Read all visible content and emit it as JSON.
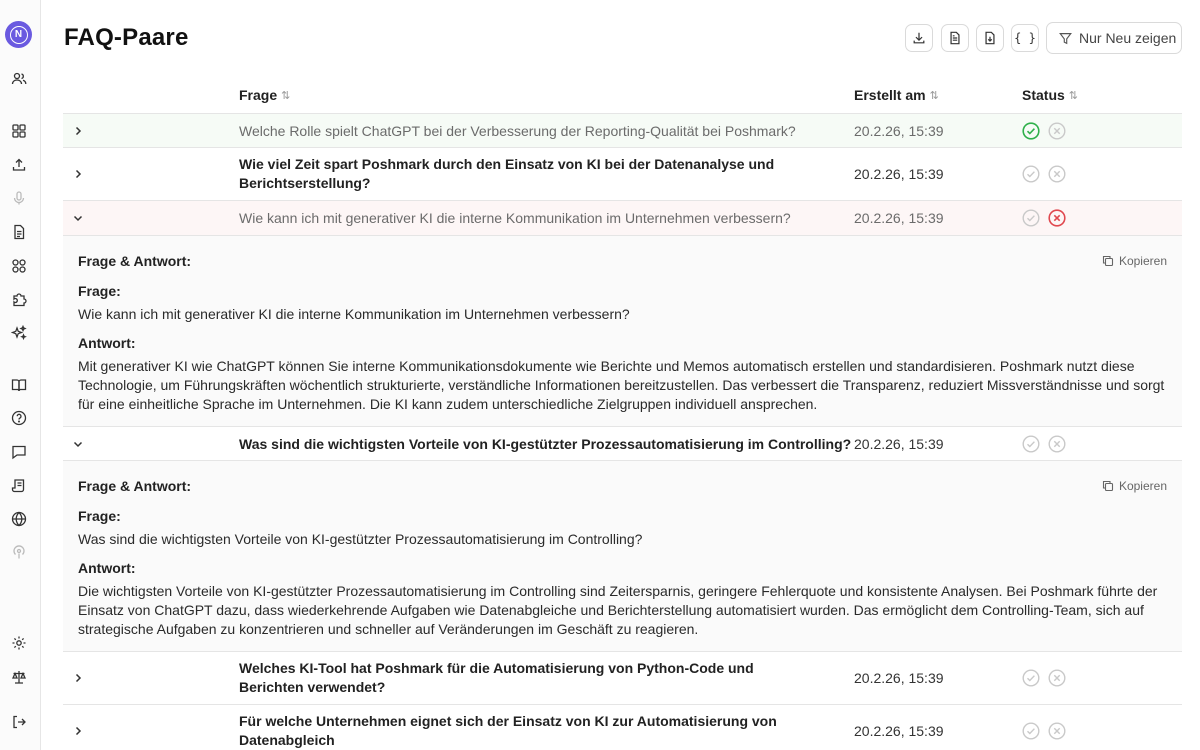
{
  "page": {
    "title": "FAQ-Paare"
  },
  "sidebar": {
    "logo_text": "N",
    "icons": [
      "users-icon",
      "dashboard-icon",
      "upload-icon",
      "microphone-icon",
      "document-icon",
      "integration-icon",
      "puzzle-icon",
      "sparkles-icon",
      "book-icon",
      "help-icon",
      "chat-icon",
      "script-icon",
      "globe-icon",
      "podcast-icon",
      "settings-icon",
      "scale-icon",
      "logout-icon"
    ]
  },
  "toolbar": {
    "buttons": [
      "download-icon",
      "file-text-icon",
      "file-download-icon",
      "code-braces-icon"
    ],
    "braces": "{ }",
    "filter_label": "Nur Neu zeigen"
  },
  "table": {
    "columns": {
      "question": "Frage",
      "created": "Erstellt am",
      "status": "Status"
    },
    "rows": [
      {
        "question": "Welche Rolle spielt ChatGPT bei der Verbesserung der Reporting-Qualität bei Poshmark?",
        "created": "20.2.26, 15:39",
        "state": "approved"
      },
      {
        "question": "Wie viel Zeit spart Poshmark durch den Einsatz von KI bei der Datenanalyse und Berichtserstellung?",
        "created": "20.2.26, 15:39",
        "state": "new"
      },
      {
        "question": "Wie kann ich mit generativer KI die interne Kommunikation im Unternehmen verbessern?",
        "created": "20.2.26, 15:39",
        "state": "rejected"
      },
      {
        "question": "Was sind die wichtigsten Vorteile von KI-gestützter Prozessautomatisierung im Controlling?",
        "created": "20.2.26, 15:39",
        "state": "new"
      },
      {
        "question": "Welches KI-Tool hat Poshmark für die Automatisierung von Python-Code und Berichten verwendet?",
        "created": "20.2.26, 15:39",
        "state": "new"
      },
      {
        "question": "Für welche Unternehmen eignet sich der Einsatz von KI zur Automatisierung von Datenabgleich",
        "created": "20.2.26, 15:39",
        "state": "new"
      }
    ],
    "details": [
      {
        "heading": "Frage & Antwort:",
        "copy_label": "Kopieren",
        "question_label": "Frage:",
        "question": "Wie kann ich mit generativer KI die interne Kommunikation im Unternehmen verbessern?",
        "answer_label": "Antwort:",
        "answer": "Mit generativer KI wie ChatGPT können Sie interne Kommunikationsdokumente wie Berichte und Memos automatisch erstellen und standardisieren. Poshmark nutzt diese Technologie, um Führungskräften wöchentlich strukturierte, verständliche Informationen bereitzustellen. Das verbessert die Transparenz, reduziert Missverständnisse und sorgt für eine einheitliche Sprache im Unternehmen. Die KI kann zudem unterschiedliche Zielgruppen individuell ansprechen."
      },
      {
        "heading": "Frage & Antwort:",
        "copy_label": "Kopieren",
        "question_label": "Frage:",
        "question": "Was sind die wichtigsten Vorteile von KI-gestützter Prozessautomatisierung im Controlling?",
        "answer_label": "Antwort:",
        "answer": "Die wichtigsten Vorteile von KI-gestützter Prozessautomatisierung im Controlling sind Zeitersparnis, geringere Fehlerquote und konsistente Analysen. Bei Poshmark führte der Einsatz von ChatGPT dazu, dass wiederkehrende Aufgaben wie Datenabgleiche und Berichterstellung automatisiert wurden. Das ermöglicht dem Controlling-Team, sich auf strategische Aufgaben zu konzentrieren und schneller auf Veränderungen im Geschäft zu reagieren."
      }
    ]
  },
  "colors": {
    "approve": "#2fb04b",
    "reject": "#e0484f",
    "inactive": "#c9c9c9",
    "brand": "#6a5ae0"
  }
}
